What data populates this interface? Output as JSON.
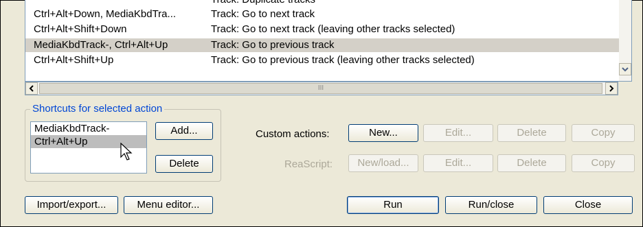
{
  "action_list": {
    "rows": [
      {
        "shortcut": "",
        "action": "Track: Duplicate tracks"
      },
      {
        "shortcut": "Ctrl+Alt+Down, MediaKbdTra...",
        "action": "Track: Go to next track"
      },
      {
        "shortcut": "Ctrl+Alt+Shift+Down",
        "action": "Track: Go to next track (leaving other tracks selected)"
      },
      {
        "shortcut": "MediaKbdTrack-, Ctrl+Alt+Up",
        "action": "Track: Go to previous track"
      },
      {
        "shortcut": "Ctrl+Alt+Shift+Up",
        "action": "Track: Go to previous track (leaving other tracks selected)"
      }
    ],
    "selected_row": 3,
    "scroll_thumb_grip": "III"
  },
  "shortcuts_group": {
    "title": "Shortcuts for selected action",
    "items": [
      "MediaKbdTrack-",
      "Ctrl+Alt+Up"
    ],
    "selected_item": 1,
    "add_label": "Add...",
    "delete_label": "Delete"
  },
  "custom_actions": {
    "label": "Custom actions:",
    "new_label": "New...",
    "edit_label": "Edit...",
    "delete_label": "Delete",
    "copy_label": "Copy"
  },
  "reascript": {
    "label": "ReaScript:",
    "new_load_label": "New/load...",
    "edit_label": "Edit...",
    "delete_label": "Delete",
    "copy_label": "Copy"
  },
  "bottom": {
    "import_export_label": "Import/export...",
    "menu_editor_label": "Menu editor...",
    "run_label": "Run",
    "run_close_label": "Run/close",
    "close_label": "Close"
  },
  "icons": {
    "scroll_down": "down-arrow-icon",
    "scroll_left": "left-arrow-icon",
    "scroll_right": "right-arrow-icon",
    "cursor": "mouse-pointer-icon"
  }
}
